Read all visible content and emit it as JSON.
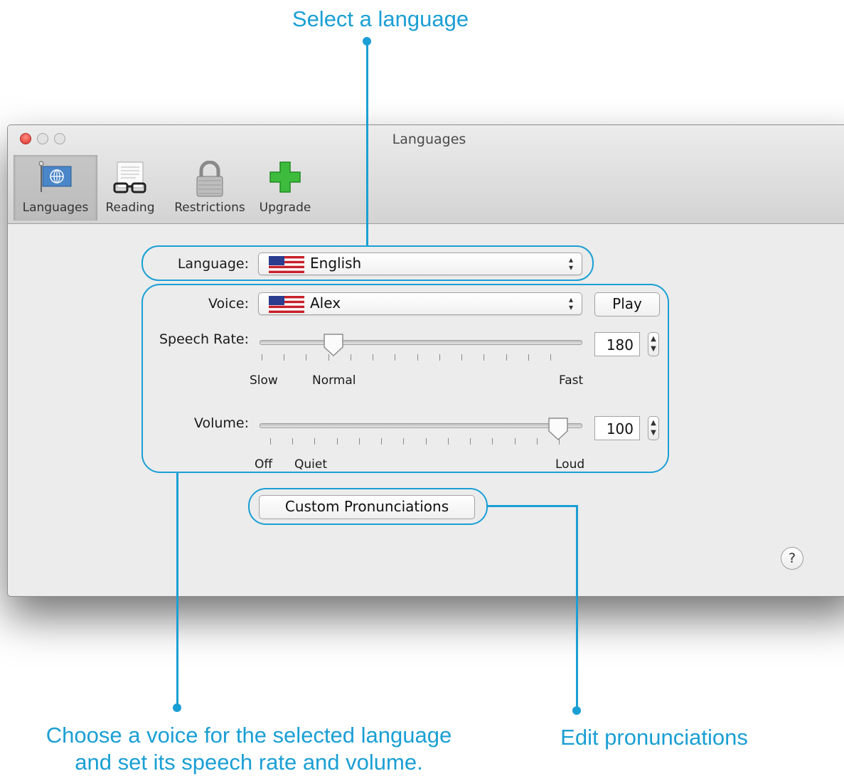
{
  "callouts": {
    "language": "Select a language",
    "voice_line1": "Choose a voice for the selected language",
    "voice_line2": "and set its speech rate and volume.",
    "pronunciations": "Edit pronunciations"
  },
  "accent_color": "#1a9fd4",
  "window": {
    "title": "Languages",
    "toolbar": [
      {
        "label": "Languages",
        "icon": "globe-flag-icon",
        "selected": true
      },
      {
        "label": "Reading",
        "icon": "glasses-document-icon",
        "selected": false
      },
      {
        "label": "Restrictions",
        "icon": "padlock-icon",
        "selected": false
      },
      {
        "label": "Upgrade",
        "icon": "green-plus-icon",
        "selected": false
      }
    ]
  },
  "form": {
    "language_label": "Language:",
    "language_value": "English",
    "language_flag": "us-flag-icon",
    "voice_label": "Voice:",
    "voice_value": "Alex",
    "voice_flag": "us-flag-icon",
    "play_label": "Play",
    "speech_rate_label": "Speech Rate:",
    "speech_rate_value": "180",
    "rate_slow": "Slow",
    "rate_normal": "Normal",
    "rate_fast": "Fast",
    "rate_fraction": 0.21,
    "volume_label": "Volume:",
    "volume_value": "100",
    "vol_off": "Off",
    "vol_quiet": "Quiet",
    "vol_loud": "Loud",
    "volume_fraction": 0.96,
    "custom_pron_label": "Custom Pronunciations",
    "help_label": "?"
  }
}
